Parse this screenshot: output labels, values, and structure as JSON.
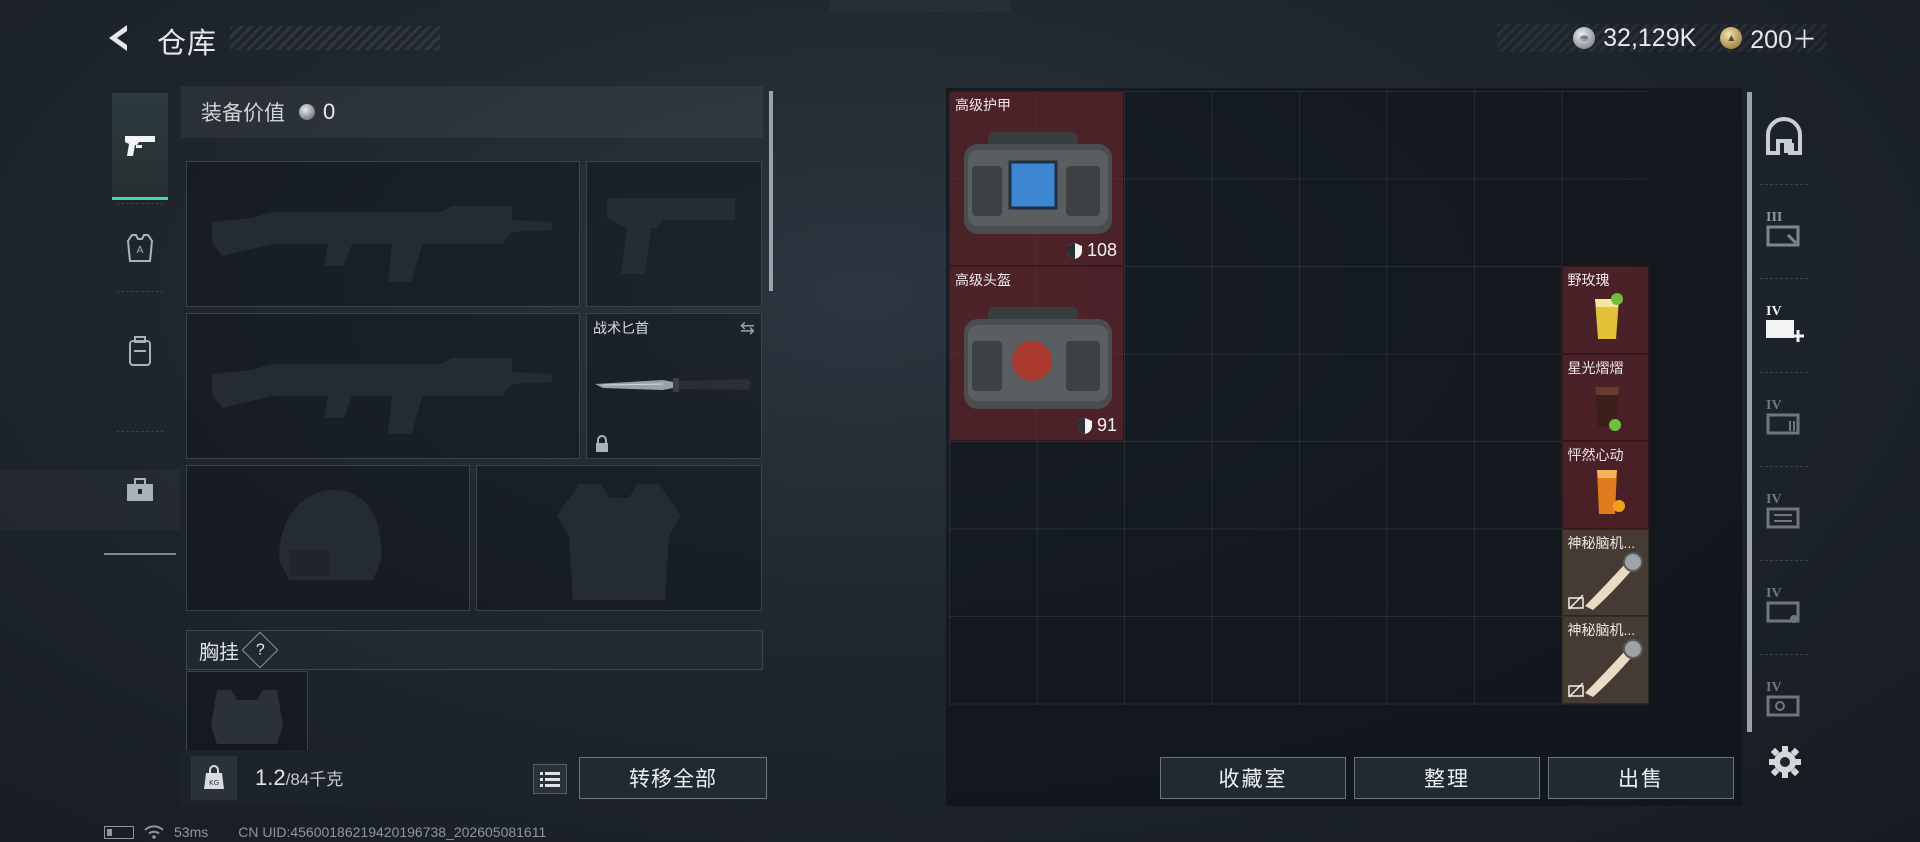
{
  "header": {
    "title": "仓库",
    "currencies": [
      {
        "icon": "silver-coin-icon",
        "value": "32,129K"
      },
      {
        "icon": "gold-coin-icon",
        "value": "200＋"
      }
    ]
  },
  "left_tabs": [
    {
      "icon": "pistol-icon",
      "active": true
    },
    {
      "icon": "armor-vest-icon",
      "active": false
    },
    {
      "icon": "backpack-icon",
      "active": false
    },
    {
      "icon": "toolbox-icon",
      "active": false
    }
  ],
  "equipment": {
    "value_label": "装备价值",
    "value": "0",
    "melee_slot_label": "战术匕首",
    "chest_rig_label": "胸挂",
    "help": "?",
    "weight_current": "1.2",
    "weight_max": "/84千克",
    "transfer_all": "转移全部"
  },
  "warehouse": {
    "items": [
      {
        "name": "高级护甲",
        "durability": "108",
        "icon": "armor-case-icon",
        "color": "#78282d"
      },
      {
        "name": "高级头盔",
        "durability": "91",
        "icon": "helmet-case-icon",
        "color": "#78282d"
      },
      {
        "name": "野玫瑰",
        "icon": "cocktail-yellow-icon",
        "color": "#78282d"
      },
      {
        "name": "星光熠熠",
        "icon": "cocktail-dark-icon",
        "color": "#78282d"
      },
      {
        "name": "怦然心动",
        "icon": "cocktail-orange-icon",
        "color": "#78282d"
      },
      {
        "name": "神秘脑机...",
        "icon": "brain-device-icon",
        "color": "#705a44",
        "no_trade": true
      },
      {
        "name": "神秘脑机...",
        "icon": "brain-device-icon",
        "color": "#705a44",
        "no_trade": true
      }
    ],
    "buttons": {
      "collection": "收藏室",
      "organize": "整理",
      "sell": "出售"
    }
  },
  "right_tabs": [
    {
      "icon": "safe-house-icon",
      "level": ""
    },
    {
      "icon": "storage-tab-icon",
      "level": "III"
    },
    {
      "icon": "storage-tab-add-icon",
      "level": "IV",
      "active": true
    },
    {
      "icon": "storage-tab-icon",
      "level": "IV"
    },
    {
      "icon": "storage-tab-icon",
      "level": "IV"
    },
    {
      "icon": "storage-tab-icon",
      "level": "IV"
    },
    {
      "icon": "storage-tab-icon",
      "level": "IV"
    }
  ],
  "status_bar": {
    "ping": "53ms",
    "uid": "CN UID:456001862194201967​38_202605081611"
  }
}
